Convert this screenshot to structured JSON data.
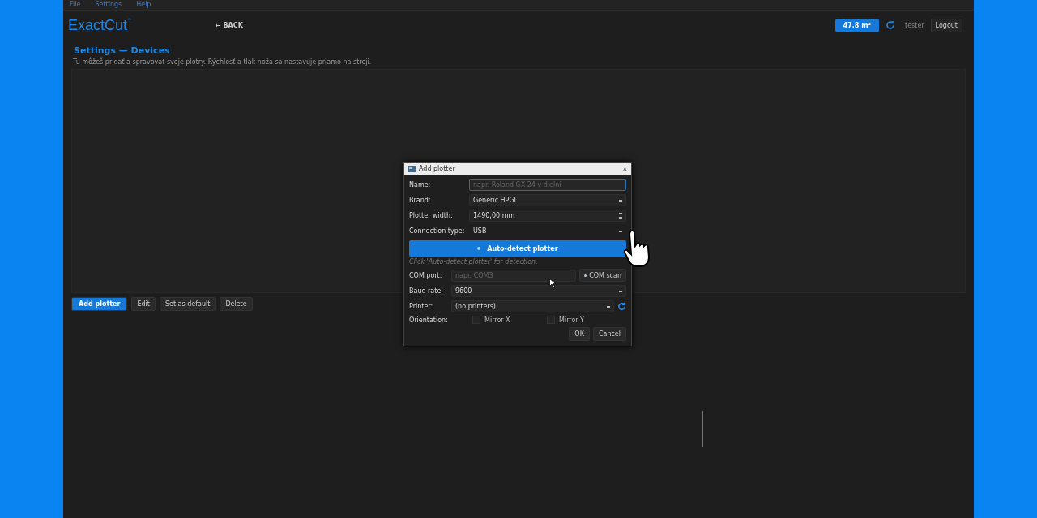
{
  "menu": [
    "File",
    "Settings",
    "Help"
  ],
  "header": {
    "logo": "ExactCut",
    "logo_mark": "™",
    "back": "← BACK",
    "area_badge": "47.8 m²",
    "user": "tester",
    "logout": "Logout"
  },
  "page": {
    "title": "Settings — Devices",
    "subtitle": "Tu môžeš pridať a spravovať svoje plotry. Rýchlosť a tlak noža sa nastavuje priamo na stroji."
  },
  "actions": [
    {
      "label": "Add plotter",
      "primary": true
    },
    {
      "label": "Edit",
      "primary": false
    },
    {
      "label": "Set as default",
      "primary": false
    },
    {
      "label": "Delete",
      "primary": false
    }
  ],
  "dialog": {
    "title": "Add plotter",
    "close": "×",
    "name": {
      "label": "Name:",
      "placeholder": "napr. Roland GX-24 v dielni"
    },
    "brand": {
      "label": "Brand:",
      "value": "Generic HPGL"
    },
    "width": {
      "label": "Plotter width:",
      "value": "1490,00 mm"
    },
    "connection": {
      "label": "Connection type:",
      "value": "USB"
    },
    "autodetect": "Auto-detect plotter",
    "hint": "Click 'Auto-detect plotter' for detection.",
    "com_port": {
      "label": "COM port:",
      "placeholder": "napr. COM3",
      "scan": "COM scan"
    },
    "baud": {
      "label": "Baud rate:",
      "value": "9600"
    },
    "printer": {
      "label": "Printer:",
      "value": "(no printers)"
    },
    "orientation": {
      "label": "Orientation:",
      "options": [
        {
          "label": "Mirror X",
          "checked": false
        },
        {
          "label": "Mirror Y",
          "checked": false
        }
      ]
    },
    "buttons": [
      "OK",
      "Cancel"
    ]
  }
}
